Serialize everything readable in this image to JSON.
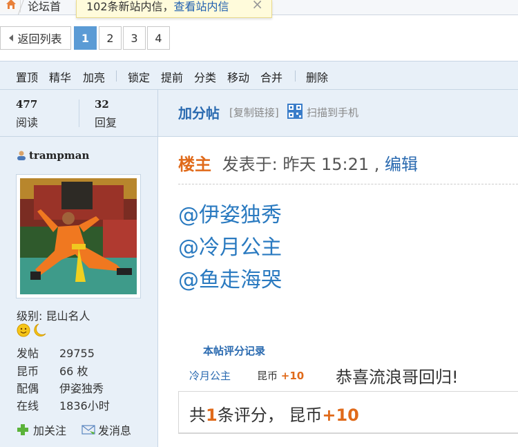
{
  "topbar": {
    "breadcrumb": "论坛首",
    "notice_text": "102条新站内信，",
    "notice_link": "查看站内信",
    "notice_close": "×"
  },
  "pager": {
    "back_label": "返回列表",
    "pages": [
      "1",
      "2",
      "3",
      "4"
    ],
    "current": "1"
  },
  "modbar": {
    "group1": [
      "置顶",
      "精华",
      "加亮"
    ],
    "group2": [
      "锁定",
      "提前",
      "分类",
      "移动",
      "合并"
    ],
    "group3": [
      "删除"
    ]
  },
  "stats": {
    "views": "477",
    "views_label": "阅读",
    "replies": "32",
    "replies_label": "回复"
  },
  "thread": {
    "title": "加分帖",
    "copy_link": "[复制链接]",
    "qr_text": "扫描到手机"
  },
  "user": {
    "name": "trampman",
    "level": "级别: 昆山名人",
    "info": [
      {
        "k": "发帖",
        "v": "29755"
      },
      {
        "k": "昆币",
        "v": "66 枚"
      },
      {
        "k": "配偶",
        "v": "伊姿独秀"
      },
      {
        "k": "在线",
        "v": "1836小时"
      }
    ],
    "follow_label": "加关注",
    "message_label": "发消息"
  },
  "post": {
    "owner": "楼主",
    "posted_at": "发表于: 昨天 15:21 ,",
    "edit": "编辑",
    "mentions": [
      "@伊姿独秀",
      "@冷月公主",
      "@鱼走海哭"
    ]
  },
  "rating": {
    "title": "本帖评分记录",
    "user": "冷月公主",
    "currency": "昆币",
    "amount": "+10",
    "reason": "恭喜流浪哥回归!",
    "summary_prefix": "共",
    "summary_count": "1",
    "summary_mid": "条评分， 昆币",
    "summary_amount": "+10"
  },
  "colors": {
    "accent_blue": "#2a6ab0",
    "accent_orange": "#e06a1a",
    "panel_bg": "#e8f0f8",
    "page_active": "#5b9bd5"
  }
}
